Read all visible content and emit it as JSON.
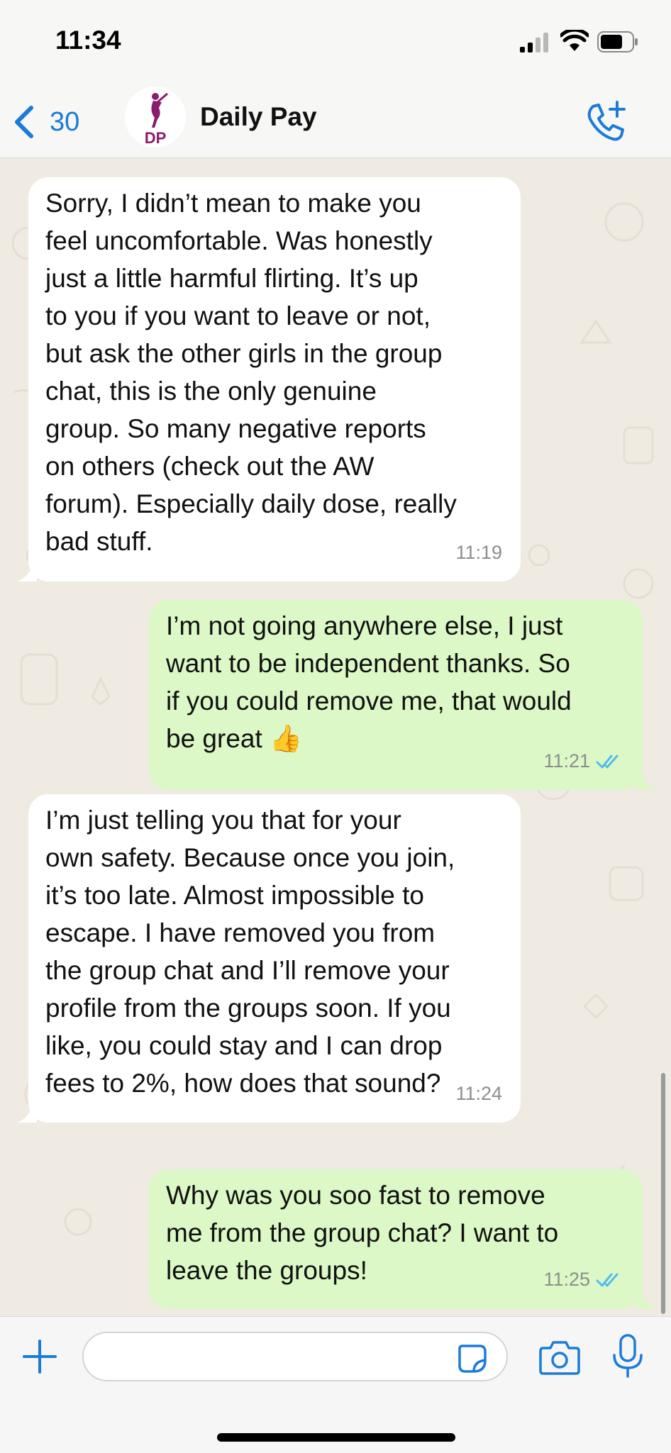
{
  "status_bar": {
    "time": "11:34",
    "icons": [
      "signal-icon",
      "wifi-icon",
      "battery-icon"
    ]
  },
  "header": {
    "back_count": "30",
    "chat_name": "Daily Pay",
    "avatar_text": "DP",
    "icons": [
      "chevron-left-icon",
      "add-call-icon"
    ]
  },
  "messages": [
    {
      "direction": "incoming",
      "text": "Sorry, I didn’t mean to make you\nfeel uncomfortable. Was honestly\njust a little harmful flirting. It’s up\nto you if you want to leave or not,\nbut ask the other girls in the group\nchat, this is the only genuine\ngroup. So many negative reports\non others (check out the AW\nforum). Especially daily dose, really\nbad stuff.",
      "time": "11:19"
    },
    {
      "direction": "outgoing",
      "text": "I’m not going anywhere else, I just\nwant to be independent thanks. So\nif you could remove me, that would\nbe great 👍",
      "time": "11:21",
      "status": "read"
    },
    {
      "direction": "incoming",
      "text": "I’m just telling you that for your\nown safety. Because once you join,\nit’s too late. Almost impossible to\nescape. I have removed you from\nthe group chat and I’ll remove your\nprofile from the groups soon. If you\nlike, you could stay and I can drop\nfees to 2%, how does that sound?",
      "time": "11:24"
    },
    {
      "direction": "outgoing",
      "text": "Why was you soo fast to remove\nme from the group chat? I want to\nleave the groups!",
      "time": "11:25",
      "status": "read"
    }
  ],
  "input_bar": {
    "placeholder": "",
    "value": "",
    "icons": [
      "plus-icon",
      "sticker-icon",
      "camera-icon",
      "microphone-icon"
    ]
  },
  "colors": {
    "accent": "#1a7bd8",
    "incoming_bubble": "#ffffff",
    "outgoing_bubble": "#dcf8c6",
    "read_ticks": "#53bdeb",
    "chat_background": "#efeae2",
    "avatar_brand": "#8a1c6e"
  }
}
